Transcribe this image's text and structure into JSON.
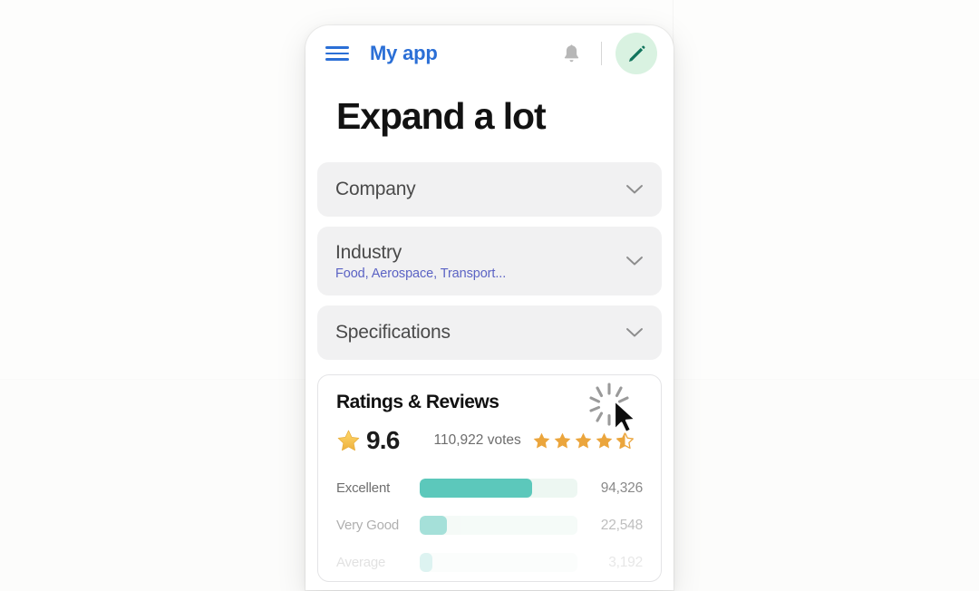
{
  "appbar": {
    "menu_icon": "hamburger-menu-icon",
    "title": "My app",
    "bell_icon": "notification-bell-icon",
    "edit_icon": "edit-pencil-icon"
  },
  "page": {
    "title": "Expand a lot"
  },
  "panels": [
    {
      "title": "Company",
      "subtitle": "",
      "chevron": "chevron-down-icon"
    },
    {
      "title": "Industry",
      "subtitle": "Food, Aerospace, Transport...",
      "chevron": "chevron-down-icon"
    },
    {
      "title": "Specifications",
      "subtitle": "",
      "chevron": "chevron-down-icon"
    }
  ],
  "ratings": {
    "title": "Ratings & Reviews",
    "score": "9.6",
    "score_star_icon": "star-icon",
    "votes": "110,922 votes",
    "stars_filled": 4,
    "stars_half": 1,
    "stars_total": 5,
    "rows": [
      {
        "label": "Excellent",
        "value": "94,326",
        "percent": 71
      },
      {
        "label": "Very Good",
        "value": "22,548",
        "percent": 17
      },
      {
        "label": "Average",
        "value": "3,192",
        "percent": 8
      }
    ],
    "cursor_icon": "mouse-cursor-icon",
    "click_burst_icon": "click-burst-icon"
  },
  "colors": {
    "brand_blue": "#2b6fd6",
    "accent_teal": "#5cc8bb",
    "fab_green_bg": "#d9f2e1",
    "fab_green_fg": "#107a58",
    "star_orange": "#eba53c",
    "panel_bg": "#f1f1f2",
    "link_purple": "#5b63c4"
  }
}
